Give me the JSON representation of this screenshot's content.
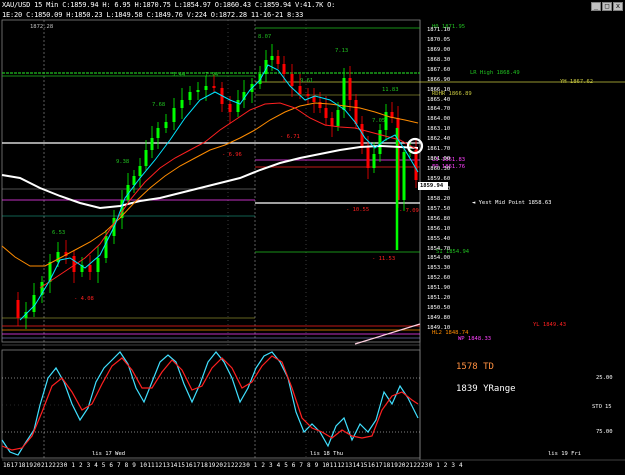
{
  "window": {
    "title_line1": "XAU/USD 15 Min  C:1859.94  H:  6.95  H:1870.75  L:1854.97  O:1860.43  C:1859.94  V:41.7K  O:",
    "title_line2": "1E:20  C:1850.09  H:1850.23  L:1849.58  C:1849.76  V:224  O:1872.28  11-16-21  8:33",
    "controls": [
      "_",
      "□",
      "x"
    ]
  },
  "prices": [
    "1871.10",
    "1870.05",
    "1869.00",
    "1868.30",
    "1867.60",
    "1866.90",
    "1866.10",
    "1865.40",
    "1864.70",
    "1864.00",
    "1863.10",
    "1862.40",
    "1861.70",
    "1861.00",
    "1860.30",
    "1859.60",
    "1858.90",
    "1858.20",
    "1857.50",
    "1856.80",
    "1856.10",
    "1855.40",
    "1854.70",
    "1854.00",
    "1853.30",
    "1852.60",
    "1851.90",
    "1851.20",
    "1850.50",
    "1849.80",
    "1849.10"
  ],
  "current_price": "1859.94",
  "levels": {
    "h0": "H0  1871.95",
    "lr_high": "LR High  1868.49",
    "yh": "YH  1867.62",
    "rdhr": "RDHR  1866.89",
    "l3": "L3  1861.83",
    "fp": "FP  1861.76",
    "yest_mid": "Yest Mid Point  1858.63",
    "s1": "S1  1854.94",
    "yl": "YL  1849.43",
    "hl2": "HL2  1848.74",
    "wp": "WP  1848.33",
    "top_left": "1872.28"
  },
  "annotations": [
    "6.53",
    "- 4.08",
    "7.68",
    "9.38",
    "5.44",
    "7.94",
    "- 6.96",
    "8.07",
    "7.13",
    "- 6.71",
    "- 10.55",
    "- 11.53",
    "7.05",
    "11.83",
    "9.61",
    "- 7.09"
  ],
  "time_axis": [
    "16",
    "17",
    "18",
    "19",
    "20",
    "21",
    "22",
    "23",
    "0",
    "1",
    "2",
    "3",
    "4",
    "5",
    "6",
    "7",
    "8",
    "9",
    "10",
    "11",
    "12",
    "13",
    "14",
    "15",
    "16",
    "17",
    "18",
    "19",
    "20",
    "21",
    "22",
    "23",
    "0",
    "1",
    "2",
    "3",
    "4",
    "5",
    "6",
    "7",
    "8",
    "9",
    "10",
    "11",
    "12",
    "13",
    "14",
    "15",
    "16",
    "17",
    "18",
    "19",
    "20",
    "21",
    "22",
    "23",
    "0",
    "1",
    "2",
    "3",
    "4"
  ],
  "day_labels": [
    "lis 17 Wed",
    "lis 18 Thu",
    "lis 19 Fri"
  ],
  "oscillator": {
    "td_label": "1578 TD",
    "yrange_label": "1839 YRange",
    "name": "STO",
    "levels": [
      "25.00",
      "15",
      "75.00"
    ]
  },
  "colors": {
    "bull_candle": "#00ff00",
    "bear_candle": "#ff0000",
    "ma_white": "#ffffff",
    "ma_orange": "#ff8c00",
    "ma_red": "#ff2020",
    "ma_cyan": "#00e5ff",
    "level_green": "#20c020",
    "level_yellow": "#c8c840",
    "level_magenta": "#ff40ff",
    "sto_cyan": "#40e0ff",
    "sto_red": "#ff2020",
    "td_orange": "#ff9040"
  }
}
